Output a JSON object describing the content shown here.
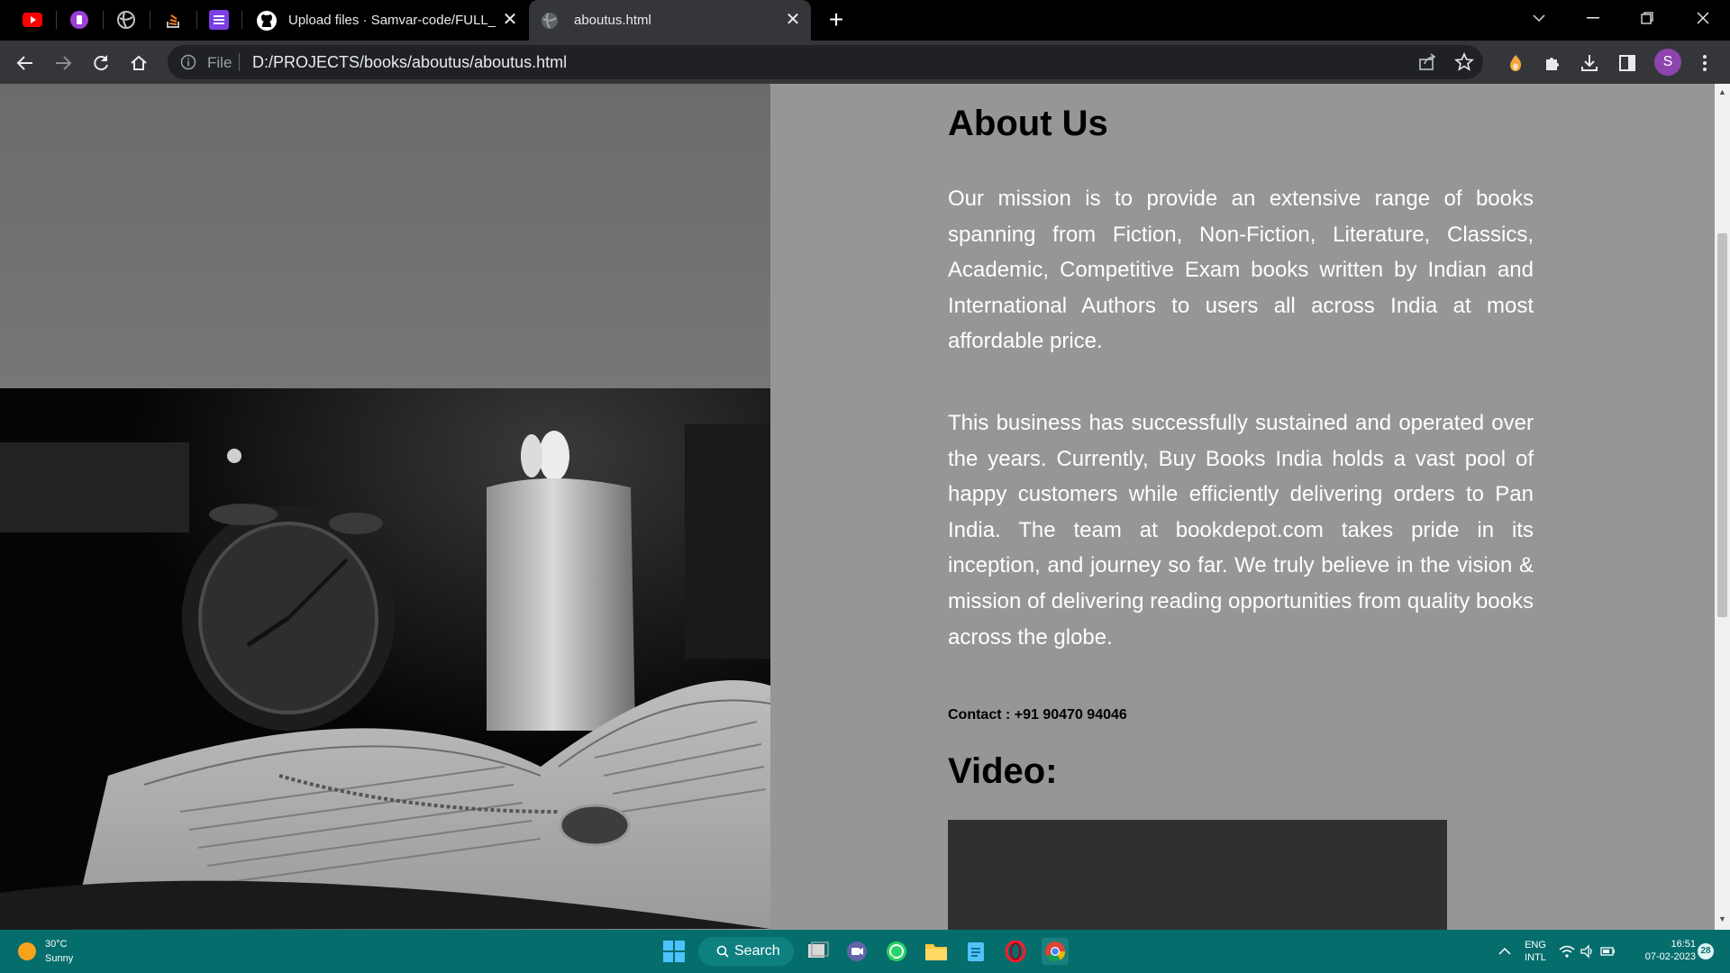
{
  "browser": {
    "tabs": [
      {
        "label": "Upload files · Samvar-code/FULL_ST",
        "active": false
      },
      {
        "label": "aboutus.html",
        "active": true
      }
    ],
    "toolbar": {
      "scheme_label": "File",
      "url": "D:/PROJECTS/books/aboutus/aboutus.html",
      "profile_initial": "S"
    }
  },
  "page": {
    "title": "About Us",
    "paragraph1": "Our mission is to provide an extensive range of books spanning from Fiction, Non-Fiction, Literature, Classics, Academic, Competitive Exam books written by Indian and International Authors to users all across India at most affordable price.",
    "paragraph2": "This business has successfully sustained and operated over the years. Currently, Buy Books India holds a vast pool of happy customers while efficiently delivering orders to Pan India. The team at bookdepot.com takes pride in its inception, and journey so far. We truly believe in the vision & mission of delivering reading opportunities from quality books across the globe.",
    "contact": "Contact : +91 90470 94046",
    "video_heading": "Video:"
  },
  "taskbar": {
    "weather_temp": "30°C",
    "weather_condition": "Sunny",
    "search_label": "Search",
    "language": "ENG",
    "keyboard": "INTL",
    "time": "16:51",
    "date": "07-02-2023",
    "notification_count": "28"
  },
  "colors": {
    "page_background": "#969696",
    "taskbar": "#066d6d",
    "tab_active": "#35363a"
  }
}
